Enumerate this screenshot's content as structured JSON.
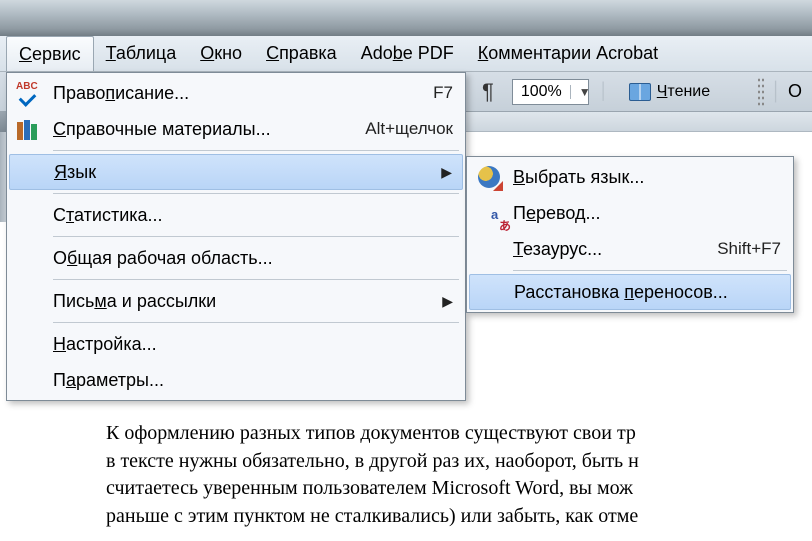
{
  "menubar": {
    "items": [
      {
        "pre": "",
        "u": "С",
        "post": "ервис"
      },
      {
        "pre": "",
        "u": "Т",
        "post": "аблица"
      },
      {
        "pre": "",
        "u": "О",
        "post": "кно"
      },
      {
        "pre": "",
        "u": "С",
        "post": "правка"
      },
      {
        "pre": "Ado",
        "u": "b",
        "post": "e PDF"
      },
      {
        "pre": "",
        "u": "К",
        "post": "омментарии Acrobat"
      }
    ]
  },
  "toolbar": {
    "zoom": "100%",
    "read_pre": "",
    "read_u": "Ч",
    "read_post": "тение",
    "truncated_right": "О"
  },
  "menu_main": [
    {
      "type": "item",
      "label_pre": "Право",
      "label_u": "п",
      "label_post": "исание...",
      "shortcut": "F7",
      "icon": "abc-check"
    },
    {
      "type": "item",
      "label_pre": "",
      "label_u": "С",
      "label_post": "правочные материалы...",
      "shortcut": "Alt+щелчок",
      "icon": "books"
    },
    {
      "type": "sep"
    },
    {
      "type": "item",
      "label_pre": "",
      "label_u": "Я",
      "label_post": "зык",
      "submenu": true,
      "hover": true
    },
    {
      "type": "sep"
    },
    {
      "type": "item",
      "label_pre": "С",
      "label_u": "т",
      "label_post": "атистика..."
    },
    {
      "type": "sep"
    },
    {
      "type": "item",
      "label_pre": "О",
      "label_u": "б",
      "label_post": "щая рабочая область..."
    },
    {
      "type": "sep"
    },
    {
      "type": "item",
      "label_pre": "Пись",
      "label_u": "м",
      "label_post": "а и рассылки",
      "submenu": true
    },
    {
      "type": "sep"
    },
    {
      "type": "item",
      "label_pre": "",
      "label_u": "Н",
      "label_post": "астройка..."
    },
    {
      "type": "item",
      "label_pre": "П",
      "label_u": "а",
      "label_post": "раметры..."
    }
  ],
  "menu_sub": [
    {
      "type": "item",
      "label_pre": "",
      "label_u": "В",
      "label_post": "ыбрать язык...",
      "icon": "globe-brush"
    },
    {
      "type": "item",
      "label_pre": "П",
      "label_u": "е",
      "label_post": "ревод...",
      "icon": "trans"
    },
    {
      "type": "item",
      "label_pre": "",
      "label_u": "Т",
      "label_post": "езаурус...",
      "shortcut": "Shift+F7"
    },
    {
      "type": "sep"
    },
    {
      "type": "item",
      "label_pre": "Расстановка ",
      "label_u": "п",
      "label_post": "ереносов...",
      "hover": true
    }
  ],
  "document": {
    "lines": [
      "К оформлению разных типов документов существуют свои тр",
      "в тексте нужны обязательно, в другой раз их, наоборот, быть н",
      "считаетесь уверенным пользователем Microsoft Word, вы мож",
      "раньше с этим пунктом не сталкивались) или забыть, как отме"
    ]
  }
}
